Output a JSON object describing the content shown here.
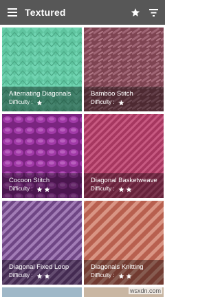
{
  "appbar": {
    "title": "Textured",
    "icons": [
      "menu-icon",
      "star-icon",
      "filter-icon"
    ]
  },
  "stitches": [
    {
      "name": "Alternating Diagonals",
      "difficulty_label": "Difficulty :",
      "stars": 1,
      "color": "#6fd3b0"
    },
    {
      "name": "Bamboo Stitch",
      "difficulty_label": "Difficulty :",
      "stars": 1,
      "color": "#8c4d5d"
    },
    {
      "name": "Cocoon Stitch",
      "difficulty_label": "Difficulty :",
      "stars": 2,
      "color": "#8a2c8c"
    },
    {
      "name": "Diagonal Basketweave",
      "difficulty_label": "Difficulty :",
      "stars": 2,
      "color": "#b8436a"
    },
    {
      "name": "Diagonal Fixed Loop",
      "difficulty_label": "Difficulty :",
      "stars": 2,
      "color": "#8a5a9a"
    },
    {
      "name": "Diagonals Knitting",
      "difficulty_label": "Difficulty :",
      "stars": 2,
      "color": "#c97765"
    }
  ],
  "watermark": "wsxdn.com"
}
